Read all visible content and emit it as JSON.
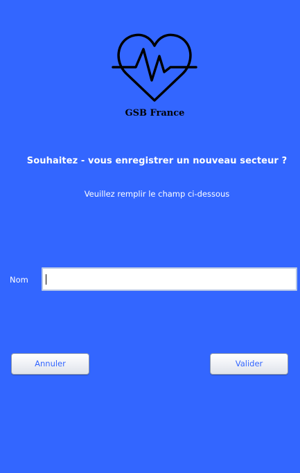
{
  "logo": {
    "icon": "heartbeat-icon",
    "brand_name": "GSB France"
  },
  "form": {
    "heading": "Souhaitez - vous enregistrer un nouveau secteur ?",
    "instruction": "Veuillez remplir le champ ci-dessous",
    "name_field": {
      "label": "Nom",
      "value": ""
    }
  },
  "actions": {
    "cancel_label": "Annuler",
    "validate_label": "Valider"
  },
  "colors": {
    "background": "#3366ff",
    "button_text": "#3366ff",
    "text": "#ffffff"
  }
}
